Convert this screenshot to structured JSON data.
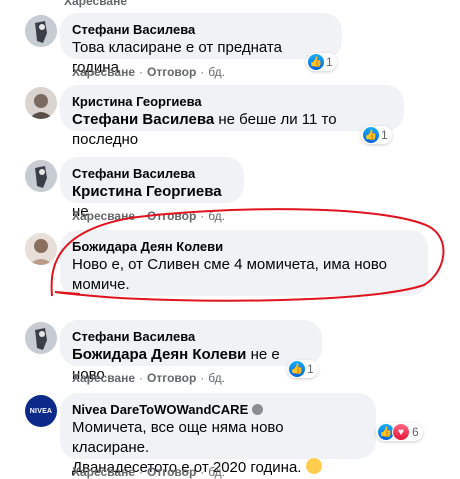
{
  "colors": {
    "bubble_bg": "#f0f2f5",
    "meta_text": "#65676b",
    "like_blue": "#1877f2",
    "highlight_red": "#e0141e"
  },
  "actions": {
    "like": "Харесване",
    "reply": "Отговор",
    "time": "бд.",
    "sep": "·"
  },
  "comments": [
    {
      "author": "Стефани Василева",
      "mention": "",
      "text": "Това класиране е от предната година",
      "reactions": [
        "like"
      ],
      "count": "1"
    },
    {
      "author": "Кристина Георгиева",
      "mention": "Стефани Василева",
      "text": "не беше ли 11 то последно",
      "reactions": [
        "like"
      ],
      "count": "1"
    },
    {
      "author": "Стефани Василева",
      "mention": "Кристина Георгиева",
      "text": "не",
      "reactions": [],
      "count": ""
    },
    {
      "author": "Божидара Деян Колеви",
      "mention": "",
      "text_line1": "Ново е, от Сливен сме 4 момичета, има ново",
      "text_line2": "момиче.",
      "reactions": [],
      "count": ""
    },
    {
      "author": "Стефани Василева",
      "mention": "Божидара Деян Колеви",
      "text": "не е ново",
      "reactions": [
        "like"
      ],
      "count": "1"
    },
    {
      "author": "Nivea DareToWOWandCARE",
      "mention": "",
      "text_line1": "Момичета, все още няма ново класиране.",
      "text_line2": "Дванадесетото е от 2020 година.",
      "avatar_text": "NIVEA",
      "reactions": [
        "like",
        "love"
      ],
      "count": "6"
    }
  ]
}
